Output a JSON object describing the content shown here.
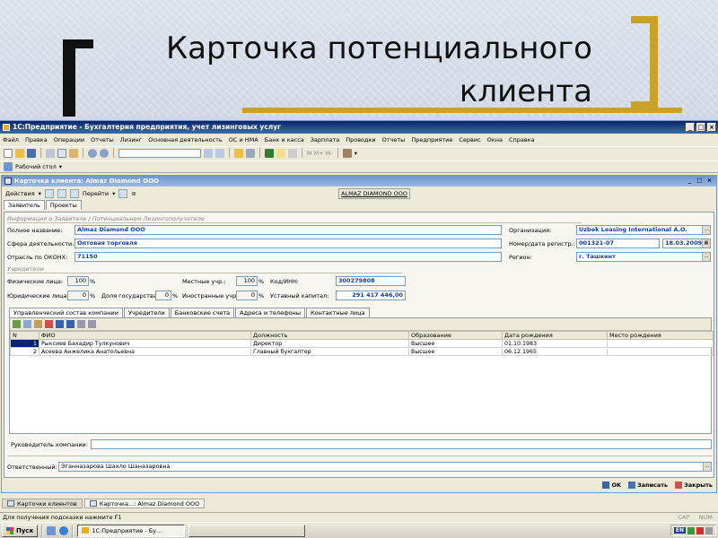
{
  "slide": {
    "title_line1": "Карточка потенциального",
    "title_line2": "клиента",
    "bracket_left_color": "#111111",
    "bracket_right_color": "#c9a227"
  },
  "app": {
    "title": "1С:Предприятие - Бухгалтерия предприятия, учет лизинговых услуг",
    "menu": [
      "Файл",
      "Правка",
      "Операции",
      "Отчеты",
      "Лизинг",
      "Основная деятельность",
      "ОС и НМА",
      "Банк и касса",
      "Зарплата",
      "Проводки",
      "Отчеты",
      "Предприятие",
      "Сервис",
      "Окна",
      "Справка"
    ],
    "toolbar": {
      "letters": "M M+ M-",
      "desktop_button": "Рабочий стол"
    }
  },
  "card": {
    "window_title": "Карточка клиента: Almaz Diamond OOO",
    "actions_label": "Действия",
    "goto_label": "Перейти",
    "header_caption": "ALMAZ DIAMOND OOO",
    "tabs": [
      "Заявитель",
      "Проекты"
    ],
    "group_info_title": "Информация о Заявителе / Потенциальном Лизингополучателе",
    "full_name_label": "Полное название:",
    "full_name_value": "Almaz Diamond OOO",
    "sphere_label": "Сфера деятельности:",
    "sphere_value": "Оптовая торговля",
    "okonh_label": "Отрасль по ОКОНХ:",
    "okonh_value": "71150",
    "org_label": "Организация:",
    "org_value": "Uzbek Leasing International A.O.",
    "regnum_label": "Номер/дата регистр.:",
    "regnum_value": "001321-07",
    "regdate_value": "18.03.2009",
    "region_label": "Регион:",
    "region_value": "г. Ташкент",
    "group_founders_title": "Учредители",
    "phys_label": "Физические лица:",
    "phys_value": "100",
    "legal_label": "Юридические лица:",
    "legal_value": "0",
    "local_label": "Местные учр.:",
    "local_value": "100",
    "state_label": "Доля государства:",
    "state_value": "0",
    "foreign_label": "Иностранные учр.:",
    "foreign_value": "0",
    "pct": "%",
    "inn_label": "Код/ИНН:",
    "inn_value": "300279808",
    "capital_label": "Уставный капитал:",
    "capital_value": "291 417 446,00",
    "subtabs": [
      "Управленческий состав компании",
      "Учредители",
      "Банковские счета",
      "Адреса и телефоны",
      "Контактные лица"
    ],
    "table": {
      "columns": [
        "N",
        "ФИО",
        "Должность",
        "Образование",
        "Дата рождения",
        "Место рождения"
      ],
      "rows": [
        [
          "1",
          "Рыксиев Бахадир Тулкунович",
          "Директор",
          "Высшее",
          "01.10.1983",
          ""
        ],
        [
          "2",
          "Асеева Анжелика Анатольевна",
          "Главный бухгалтер",
          "Высшее",
          "06.12.1965",
          ""
        ]
      ]
    },
    "head_label": "Руководитель компании:",
    "head_value": "",
    "responsible_label": "Ответственный:",
    "responsible_value": "Эганназарова Шахло Шаназаровна",
    "ok_label": "OK",
    "save_label": "Записать",
    "close_label": "Закрыть"
  },
  "window_tabs": [
    "Карточки клиентов",
    "Карточка...: Almaz Diamond OOO"
  ],
  "status": {
    "hint": "Для получения подсказки нажмите F1",
    "cap": "CAP",
    "num": "NUM"
  },
  "taskbar": {
    "start": "Пуск",
    "task": "1С:Предприятие - Бу...",
    "lang": "EN"
  },
  "colors": {
    "titlebar": "#0a246a",
    "accent_blue": "#1c3aa0",
    "window_bg": "#ece9d8"
  }
}
